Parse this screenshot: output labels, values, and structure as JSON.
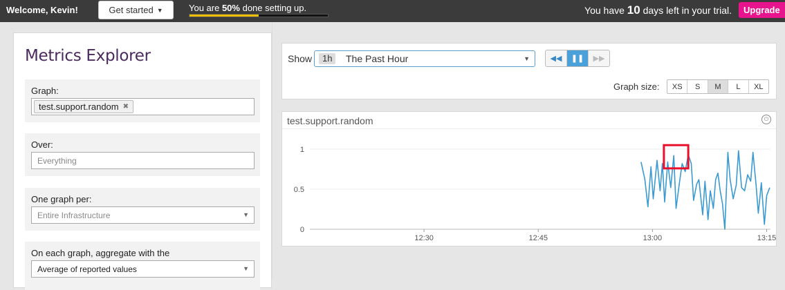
{
  "topbar": {
    "welcome": "Welcome, Kevin!",
    "get_started": "Get started",
    "progress_prefix": "You are ",
    "progress_pct_text": "50%",
    "progress_suffix": " done setting up.",
    "progress_fraction": 0.5,
    "trial_prefix": "You have ",
    "trial_days": "10",
    "trial_suffix": " days left in your trial.",
    "upgrade": "Upgrade",
    "progress_color": "#f0c000",
    "upgrade_color": "#e8148d"
  },
  "metrics_explorer": {
    "title": "Metrics Explorer",
    "graph": {
      "label": "Graph:",
      "tags": [
        "test.support.random"
      ]
    },
    "over": {
      "label": "Over:",
      "placeholder": "Everything"
    },
    "one_graph_per": {
      "label": "One graph per:",
      "value": "Entire Infrastructure"
    },
    "aggregate": {
      "label": "On each graph, aggregate with the",
      "value": "Average of reported values"
    }
  },
  "controls": {
    "show_label": "Show",
    "time_chip": "1h",
    "time_label": "The Past Hour",
    "media": [
      "rewind-icon",
      "pause-icon",
      "fast-forward-icon"
    ],
    "graph_size_label": "Graph size:",
    "sizes": [
      "XS",
      "S",
      "M",
      "L",
      "XL"
    ],
    "active_size": "M"
  },
  "graph": {
    "title": "test.support.random"
  },
  "chart_data": {
    "type": "line",
    "title": "test.support.random",
    "xlabel": "",
    "ylabel": "",
    "x_ticks": [
      "12:30",
      "12:45",
      "13:00",
      "13:15"
    ],
    "y_ticks": [
      0,
      0.5,
      1
    ],
    "ylim": [
      0,
      1
    ],
    "xlim_minutes": [
      15.0,
      75.5
    ],
    "series_color": "#3a9ad1",
    "highlight_color": "#e8102a",
    "series": [
      {
        "x": [
          58.5,
          59.0,
          59.4,
          59.8,
          60.1,
          60.6,
          61.0,
          61.3,
          61.6,
          62.0,
          62.4,
          62.8,
          63.1,
          63.6,
          63.9,
          64.3,
          64.7,
          65.1,
          65.4,
          65.8,
          66.1,
          66.6,
          66.9,
          67.3,
          67.6,
          68.0,
          68.3,
          68.6,
          68.9,
          69.2,
          69.5,
          69.9,
          70.2,
          70.6,
          71.0,
          71.3,
          71.7,
          72.1,
          72.5,
          72.9,
          73.2,
          73.6,
          73.9,
          74.3,
          74.7,
          75.0,
          75.4
        ],
        "y": [
          0.84,
          0.62,
          0.28,
          0.78,
          0.38,
          0.86,
          0.48,
          0.82,
          0.34,
          0.84,
          0.52,
          0.92,
          0.26,
          0.62,
          0.82,
          0.72,
          0.93,
          0.82,
          0.36,
          0.56,
          0.62,
          0.18,
          0.6,
          0.12,
          0.48,
          0.26,
          0.62,
          0.7,
          0.48,
          0.32,
          0.0,
          0.96,
          0.62,
          0.38,
          0.55,
          0.98,
          0.52,
          0.48,
          0.68,
          0.6,
          0.96,
          0.56,
          0.2,
          0.58,
          0.06,
          0.42,
          0.52
        ]
      }
    ],
    "highlight_box": {
      "x_from": 61.5,
      "x_to": 64.7,
      "y_from": 0.76,
      "y_to": 1.05
    }
  }
}
